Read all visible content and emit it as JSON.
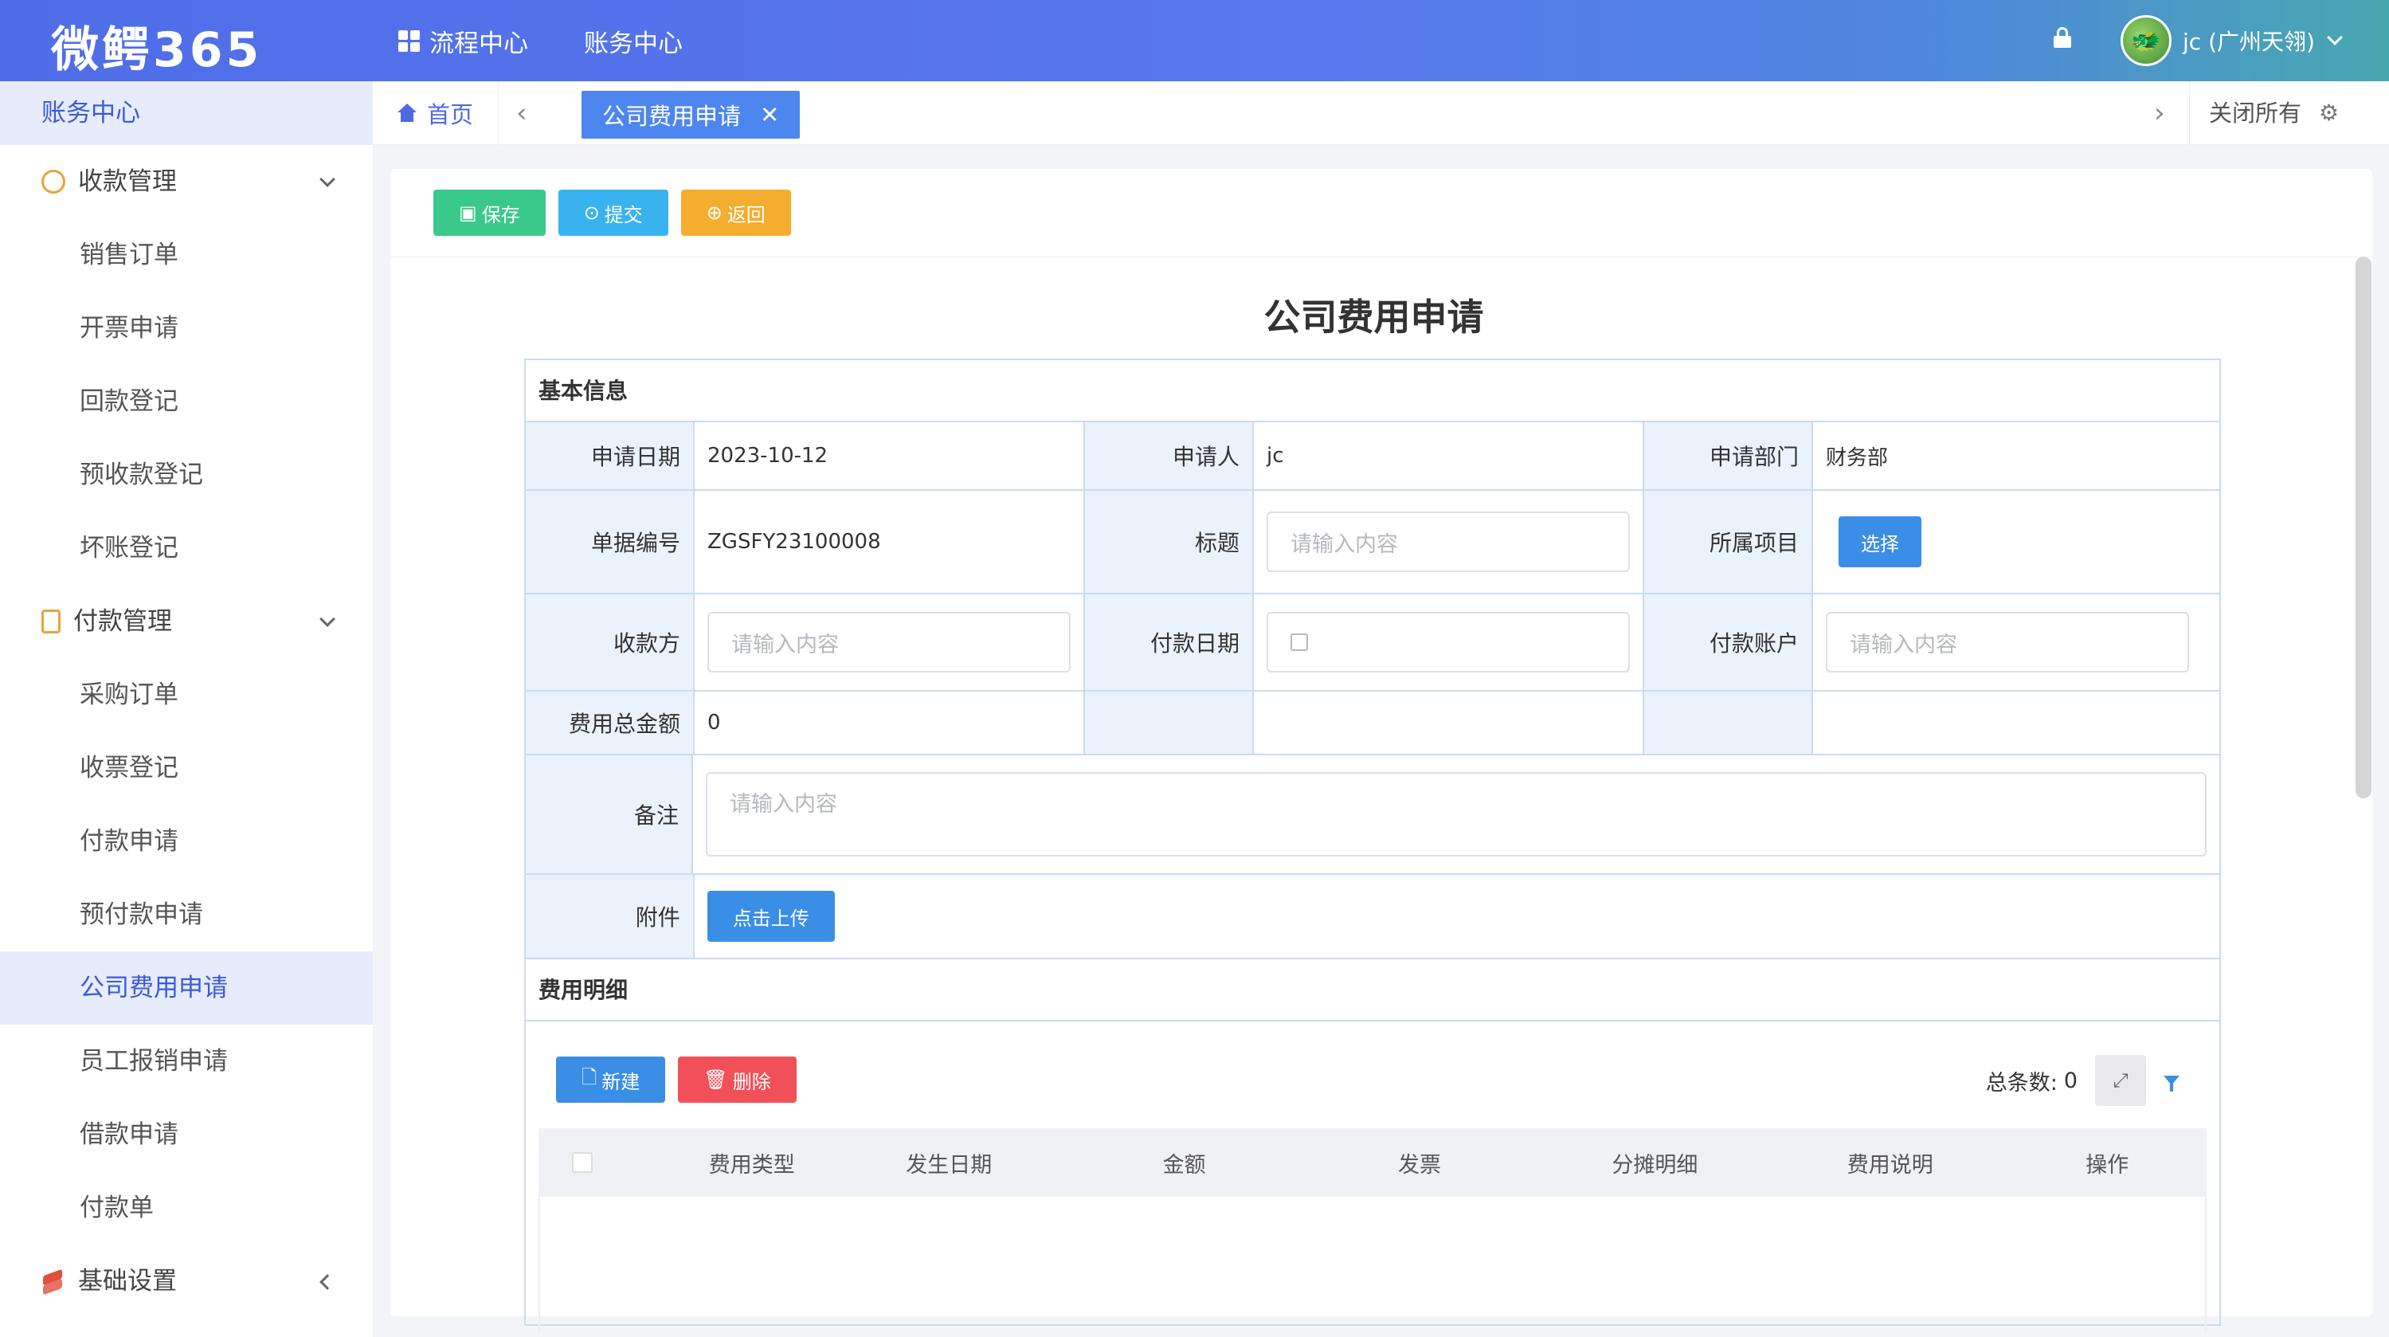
{
  "app": {
    "logo": "微鳄365",
    "nav": [
      "流程中心",
      "账务中心"
    ],
    "user": "jc (广州天翎)",
    "avatar_icon": "dragon"
  },
  "sidebar": {
    "title": "账务中心",
    "groups": [
      {
        "label": "收款管理",
        "icon": "coin-icon",
        "items": [
          "销售订单",
          "开票申请",
          "回款登记",
          "预收款登记",
          "坏账登记"
        ]
      },
      {
        "label": "付款管理",
        "icon": "clipboard-icon",
        "items": [
          "采购订单",
          "收票登记",
          "付款申请",
          "预付款申请",
          "公司费用申请",
          "员工报销申请",
          "借款申请",
          "付款单"
        ]
      },
      {
        "label": "基础设置",
        "icon": "layers-icon",
        "items": []
      }
    ],
    "active_item": "公司费用申请"
  },
  "tabs": {
    "home": "首页",
    "active": "公司费用申请",
    "close_all": "关闭所有"
  },
  "toolbar": {
    "save": "保存",
    "submit": "提交",
    "back": "返回"
  },
  "form": {
    "title": "公司费用申请",
    "section_basic": "基本信息",
    "apply_date_label": "申请日期",
    "apply_date": "2023-10-12",
    "applicant_label": "申请人",
    "applicant": "jc",
    "dept_label": "申请部门",
    "dept": "财务部",
    "doc_no_label": "单据编号",
    "doc_no": "ZGSFY23100008",
    "subject_label": "标题",
    "subject_placeholder": "请输入内容",
    "project_label": "所属项目",
    "project_button": "选择",
    "payee_label": "收款方",
    "payee_placeholder": "请输入内容",
    "pay_date_label": "付款日期",
    "pay_account_label": "付款账户",
    "pay_account_placeholder": "请输入内容",
    "total_label": "费用总金额",
    "total": "0",
    "remark_label": "备注",
    "remark_placeholder": "请输入内容",
    "attach_label": "附件",
    "upload_button": "点击上传",
    "section_detail": "费用明细"
  },
  "detail": {
    "new_button": "新建",
    "delete_button": "删除",
    "count_label": "总条数:",
    "count": "0",
    "columns": [
      "费用类型",
      "发生日期",
      "金额",
      "发票",
      "分摊明细",
      "费用说明",
      "操作"
    ]
  },
  "colors": {
    "accent": "#4d6ae4",
    "save": "#38c98b",
    "submit": "#39b3f0",
    "back": "#f3ad2f",
    "delete": "#f25058"
  }
}
